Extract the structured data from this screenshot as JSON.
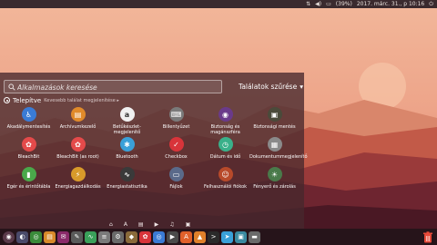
{
  "top_panel": {
    "battery": "(39%)",
    "datetime": "2017. márc. 31., p 10:16",
    "icons": [
      "network-icon",
      "sound-icon",
      "battery-icon",
      "power-icon"
    ]
  },
  "dash": {
    "search_placeholder": "Alkalmazások keresése",
    "filter_label": "Találatok szűrése",
    "filter_arrow": "▾",
    "section_title": "Telepítve",
    "section_subtitle": "Kevesebb találat megjelenítése ▸",
    "apps": [
      {
        "label": "Akadálymentesítés",
        "color": "#3a7bd5",
        "glyph": "♿"
      },
      {
        "label": "Archívumkezelő",
        "color": "#e08a2a",
        "glyph": "▤"
      },
      {
        "label": "Betűkészlet-megjelenítő",
        "color": "#f0f0f0",
        "glyph": "a"
      },
      {
        "label": "Billentyűzet",
        "color": "#7a7a7a",
        "glyph": "⌨"
      },
      {
        "label": "Biztonság és magánszféra",
        "color": "#6a3a8a",
        "glyph": "◉"
      },
      {
        "label": "Biztonsági mentés",
        "color": "#4a4a3a",
        "glyph": "▣"
      },
      {
        "label": "BleachBit",
        "color": "#e44a4a",
        "glyph": "✿"
      },
      {
        "label": "BleachBit (as root)",
        "color": "#e44a4a",
        "glyph": "✿"
      },
      {
        "label": "Bluetooth",
        "color": "#3aa0d8",
        "glyph": "✱"
      },
      {
        "label": "Checkbox",
        "color": "#d8343a",
        "glyph": "✓"
      },
      {
        "label": "Dátum és idő",
        "color": "#3ab08a",
        "glyph": "◷"
      },
      {
        "label": "Dokumentummegjelenítő",
        "color": "#8a8a8a",
        "glyph": "▦"
      },
      {
        "label": "Egér és érintőtábla",
        "color": "#4aa84a",
        "glyph": "▮"
      },
      {
        "label": "Energiagazdálkodás",
        "color": "#d89a2a",
        "glyph": "⚡"
      },
      {
        "label": "Energiastatisztika",
        "color": "#3a3a3a",
        "glyph": "∿"
      },
      {
        "label": "Fájlok",
        "color": "#5a6a8a",
        "glyph": "▭"
      },
      {
        "label": "Felhasználói fiókok",
        "color": "#b84a2a",
        "glyph": "☺"
      },
      {
        "label": "Fényerő és zárolás",
        "color": "#4a7a4a",
        "glyph": "☀"
      }
    ]
  },
  "lens_bar": [
    "⌂",
    "A",
    "▤",
    "▶",
    "♫",
    "▣"
  ],
  "dock": [
    {
      "name": "ubuntu-logo-icon",
      "color": "#5a3a4a",
      "glyph": "◉"
    },
    {
      "name": "browser-icon",
      "color": "#4a4a6a",
      "glyph": "◐"
    },
    {
      "name": "chrome-icon",
      "color": "#3a8a3a",
      "glyph": "◎"
    },
    {
      "name": "files-icon",
      "color": "#d88a2a",
      "glyph": "▤"
    },
    {
      "name": "mail-icon",
      "color": "#8a2a6a",
      "glyph": "✉"
    },
    {
      "name": "inkscape-icon",
      "color": "#5a5a5a",
      "glyph": "✎"
    },
    {
      "name": "monitor-icon",
      "color": "#3aa05a",
      "glyph": "∿"
    },
    {
      "name": "text-editor-icon",
      "color": "#7a7a7a",
      "glyph": "≡"
    },
    {
      "name": "settings-icon",
      "color": "#6a6a6a",
      "glyph": "⚙"
    },
    {
      "name": "gimp-icon",
      "color": "#8a6a3a",
      "glyph": "◆"
    },
    {
      "name": "bleachbit-icon",
      "color": "#d8343a",
      "glyph": "✿"
    },
    {
      "name": "chromium-icon",
      "color": "#3a7bd5",
      "glyph": "◎"
    },
    {
      "name": "dev-icon",
      "color": "#4a4a4a",
      "glyph": "▶"
    },
    {
      "name": "software-center-icon",
      "color": "#e0602a",
      "glyph": "A"
    },
    {
      "name": "vlc-icon",
      "color": "#e0802a",
      "glyph": "▲"
    },
    {
      "name": "terminal-icon",
      "color": "#2a2a2a",
      "glyph": ">"
    },
    {
      "name": "telegram-icon",
      "color": "#3aa0d8",
      "glyph": "➤"
    },
    {
      "name": "image-viewer-icon",
      "color": "#3a8aa0",
      "glyph": "▣"
    },
    {
      "name": "drive-icon",
      "color": "#6a6a6a",
      "glyph": "▬"
    }
  ]
}
